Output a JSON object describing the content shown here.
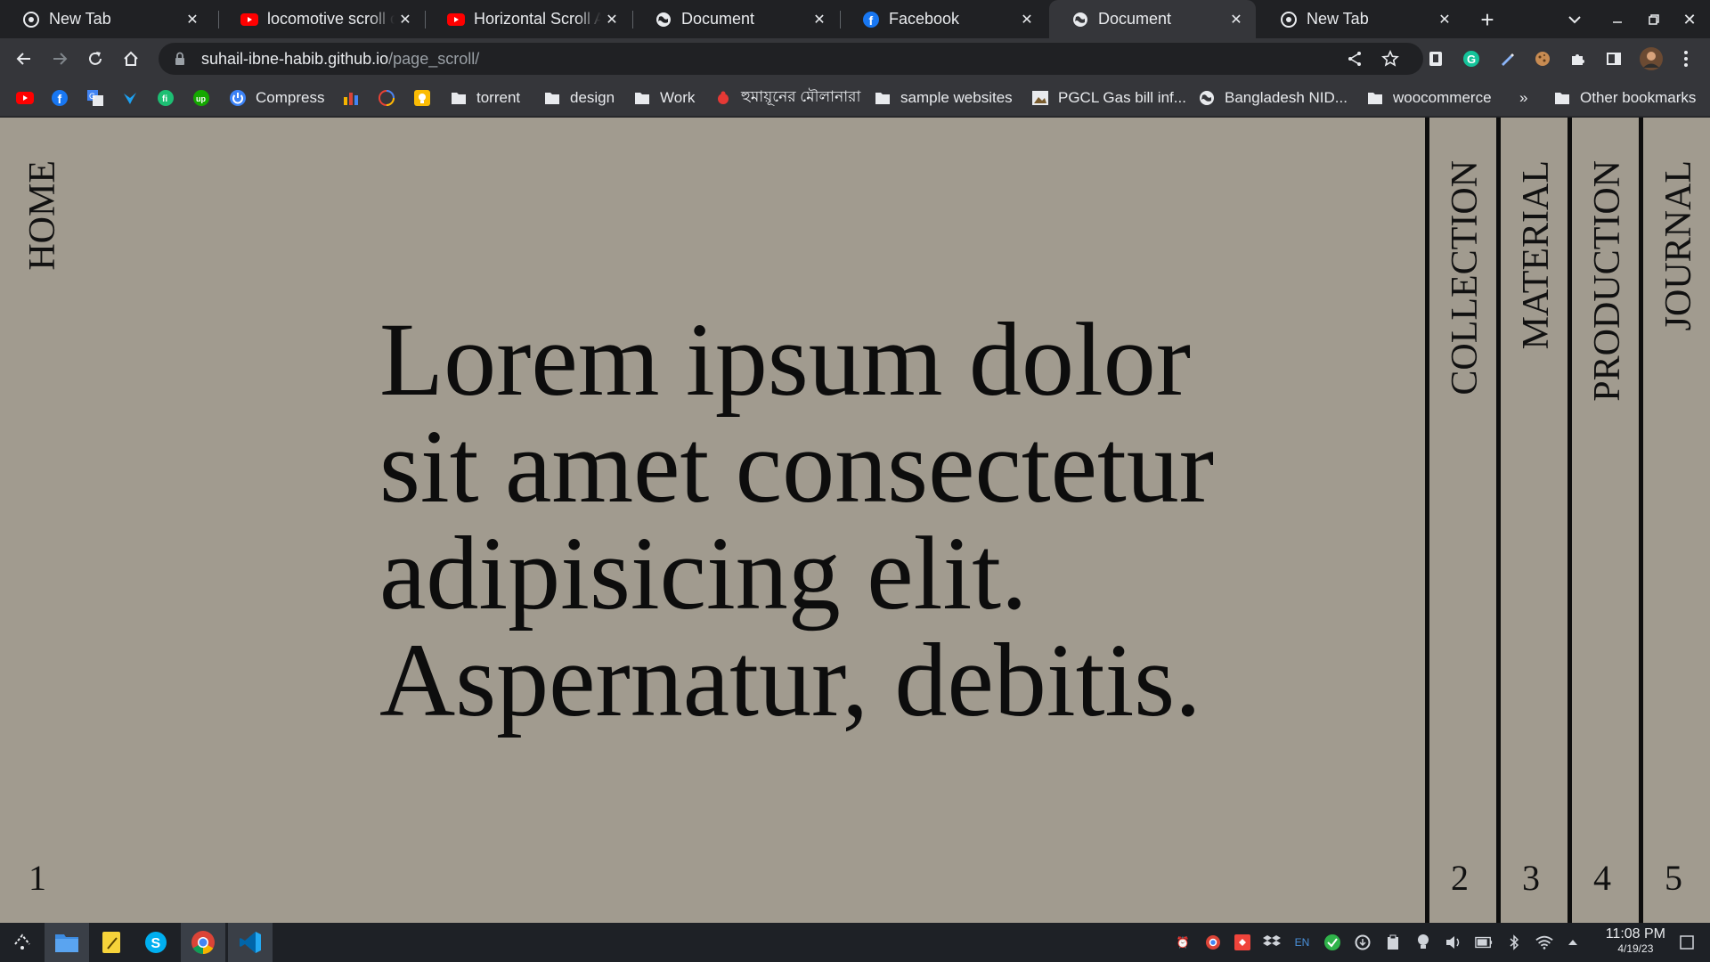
{
  "browser": {
    "tabs": [
      {
        "title": "New Tab",
        "favicon": "chrome-icon"
      },
      {
        "title": "locomotive scroll crash",
        "favicon": "youtube-icon"
      },
      {
        "title": "Horizontal Scroll Animation",
        "favicon": "youtube-icon"
      },
      {
        "title": "Document",
        "favicon": "globe-icon"
      },
      {
        "title": "Facebook",
        "favicon": "facebook-icon"
      },
      {
        "title": "Document",
        "favicon": "globe-icon",
        "active": true
      },
      {
        "title": "New Tab",
        "favicon": "chrome-icon"
      }
    ],
    "address": {
      "host": "suhail-ibne-habib.github.io",
      "path": "/page_scroll/"
    },
    "bookmarks": [
      {
        "label": "",
        "icon": "youtube-icon"
      },
      {
        "label": "",
        "icon": "facebook-icon"
      },
      {
        "label": "",
        "icon": "translate-icon"
      },
      {
        "label": "",
        "icon": "bird-icon"
      },
      {
        "label": "",
        "icon": "fiverr-icon"
      },
      {
        "label": "",
        "icon": "upwork-icon"
      },
      {
        "label": "Compress",
        "icon": "power-icon"
      },
      {
        "label": "",
        "icon": "chart-icon"
      },
      {
        "label": "",
        "icon": "ring-icon"
      },
      {
        "label": "",
        "icon": "bulb-icon"
      },
      {
        "label": "torrent",
        "icon": "folder-icon"
      },
      {
        "label": "design",
        "icon": "folder-icon"
      },
      {
        "label": "Work",
        "icon": "folder-icon"
      },
      {
        "label": "হুমায়ূনের মৌলানারা",
        "icon": "bug-icon"
      },
      {
        "label": "sample websites",
        "icon": "folder-icon"
      },
      {
        "label": "PGCL Gas bill inf...",
        "icon": "image-icon"
      },
      {
        "label": "Bangladesh NID...",
        "icon": "globe-icon"
      },
      {
        "label": "woocommerce",
        "icon": "folder-icon"
      },
      {
        "label": "»",
        "icon": ""
      },
      {
        "label": "Other bookmarks",
        "icon": "folder-icon"
      }
    ]
  },
  "page": {
    "home_label": "HOME",
    "home_number": "1",
    "hero_text": "Lorem ipsum dolor sit amet consectetur adipisicing elit. Aspernatur, debitis.",
    "panels": [
      {
        "label": "COLLECTION",
        "number": "2"
      },
      {
        "label": "MATERIAL",
        "number": "3"
      },
      {
        "label": "PRODUCTION",
        "number": "4"
      },
      {
        "label": "JOURNAL",
        "number": "5"
      }
    ],
    "background_color": "#a19b8f"
  },
  "taskbar": {
    "apps": [
      "launcher-icon",
      "file-manager-icon",
      "notes-icon",
      "skype-icon",
      "chrome-icon",
      "vscode-icon"
    ],
    "tray_language": "EN",
    "time": "11:08 PM",
    "date": "4/19/23"
  }
}
